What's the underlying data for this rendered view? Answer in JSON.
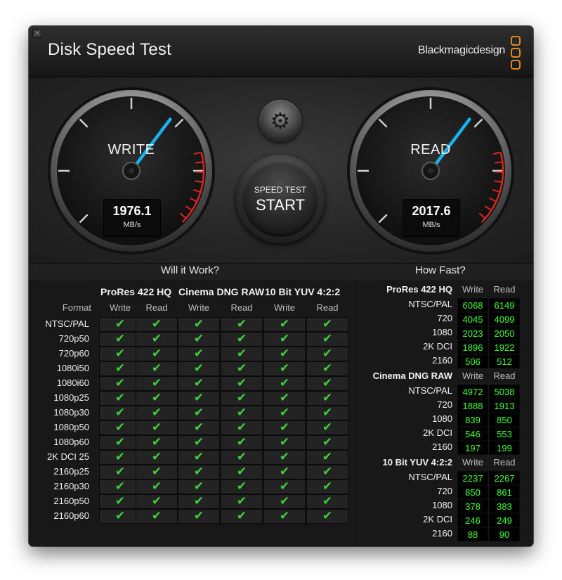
{
  "window": {
    "title": "Disk Speed Test",
    "close_glyph": "×",
    "brand": "Blackmagicdesign",
    "brand_color": "#e08a1e"
  },
  "gauges": {
    "write": {
      "label": "WRITE",
      "value": "1976.1",
      "unit": "MB/s",
      "needle_color": "#19b3f0"
    },
    "read": {
      "label": "READ",
      "value": "2017.6",
      "unit": "MB/s",
      "needle_color": "#19b3f0"
    }
  },
  "controls": {
    "settings_icon": "gear-icon",
    "start_top": "SPEED TEST",
    "start_main": "START"
  },
  "will_it_work": {
    "title": "Will it Work?",
    "format_header": "Format",
    "groups": [
      "ProRes 422 HQ",
      "Cinema DNG RAW",
      "10 Bit YUV 4:2:2"
    ],
    "sub_headers": [
      "Write",
      "Read",
      "Write",
      "Read",
      "Write",
      "Read"
    ],
    "formats": [
      "NTSC/PAL",
      "720p50",
      "720p60",
      "1080i50",
      "1080i60",
      "1080p25",
      "1080p30",
      "1080p50",
      "1080p60",
      "2K DCI 25",
      "2160p25",
      "2160p30",
      "2160p50",
      "2160p60"
    ],
    "check_glyph": "✔",
    "check_color": "#3ed13a"
  },
  "how_fast": {
    "title": "How Fast?",
    "col_write": "Write",
    "col_read": "Read",
    "value_color": "#3cff2b",
    "groups": [
      {
        "name": "ProRes 422 HQ",
        "rows": [
          {
            "label": "NTSC/PAL",
            "write": "6068",
            "read": "6149"
          },
          {
            "label": "720",
            "write": "4045",
            "read": "4099"
          },
          {
            "label": "1080",
            "write": "2023",
            "read": "2050"
          },
          {
            "label": "2K DCI",
            "write": "1896",
            "read": "1922"
          },
          {
            "label": "2160",
            "write": "506",
            "read": "512"
          }
        ]
      },
      {
        "name": "Cinema DNG RAW",
        "rows": [
          {
            "label": "NTSC/PAL",
            "write": "4972",
            "read": "5038"
          },
          {
            "label": "720",
            "write": "1888",
            "read": "1913"
          },
          {
            "label": "1080",
            "write": "839",
            "read": "850"
          },
          {
            "label": "2K DCI",
            "write": "546",
            "read": "553"
          },
          {
            "label": "2160",
            "write": "197",
            "read": "199"
          }
        ]
      },
      {
        "name": "10 Bit YUV 4:2:2",
        "rows": [
          {
            "label": "NTSC/PAL",
            "write": "2237",
            "read": "2267"
          },
          {
            "label": "720",
            "write": "850",
            "read": "861"
          },
          {
            "label": "1080",
            "write": "378",
            "read": "383"
          },
          {
            "label": "2K DCI",
            "write": "246",
            "read": "249"
          },
          {
            "label": "2160",
            "write": "88",
            "read": "90"
          }
        ]
      }
    ]
  }
}
